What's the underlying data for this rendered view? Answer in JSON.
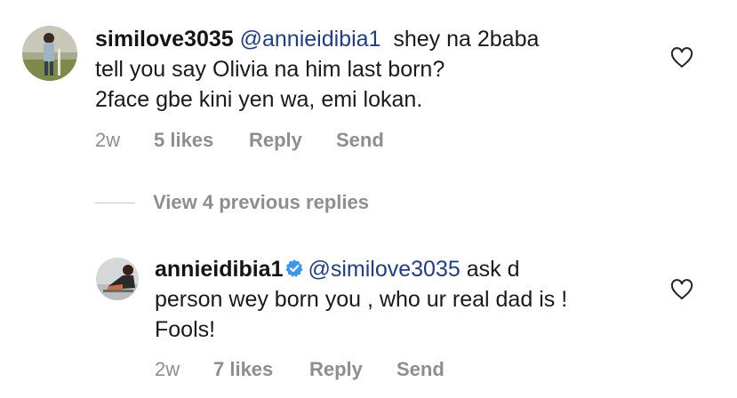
{
  "comment": {
    "username": "similove3035",
    "mention": "@annieidibia1",
    "text_line1": "shey na 2baba",
    "text_line2": "tell you say Olivia na him last born?",
    "text_line3": "2face gbe kini yen wa, emi lokan.",
    "age": "2w",
    "likes": "5 likes",
    "reply_label": "Reply",
    "send_label": "Send"
  },
  "view_replies": {
    "label": "View 4 previous replies"
  },
  "reply": {
    "username": "annieidibia1",
    "verified": true,
    "mention": "@similove3035",
    "text_line1": "ask d",
    "text_line2": "person wey born you , who ur real dad is !",
    "text_line3": "Fools!",
    "age": "2w",
    "likes": "7 likes",
    "reply_label": "Reply",
    "send_label": "Send"
  },
  "colors": {
    "mention": "#1d3f8a",
    "meta": "#8e8e8e",
    "verified": "#3897f0"
  },
  "icons": {
    "like": "heart-outline-icon",
    "verified": "verified-badge-icon"
  }
}
